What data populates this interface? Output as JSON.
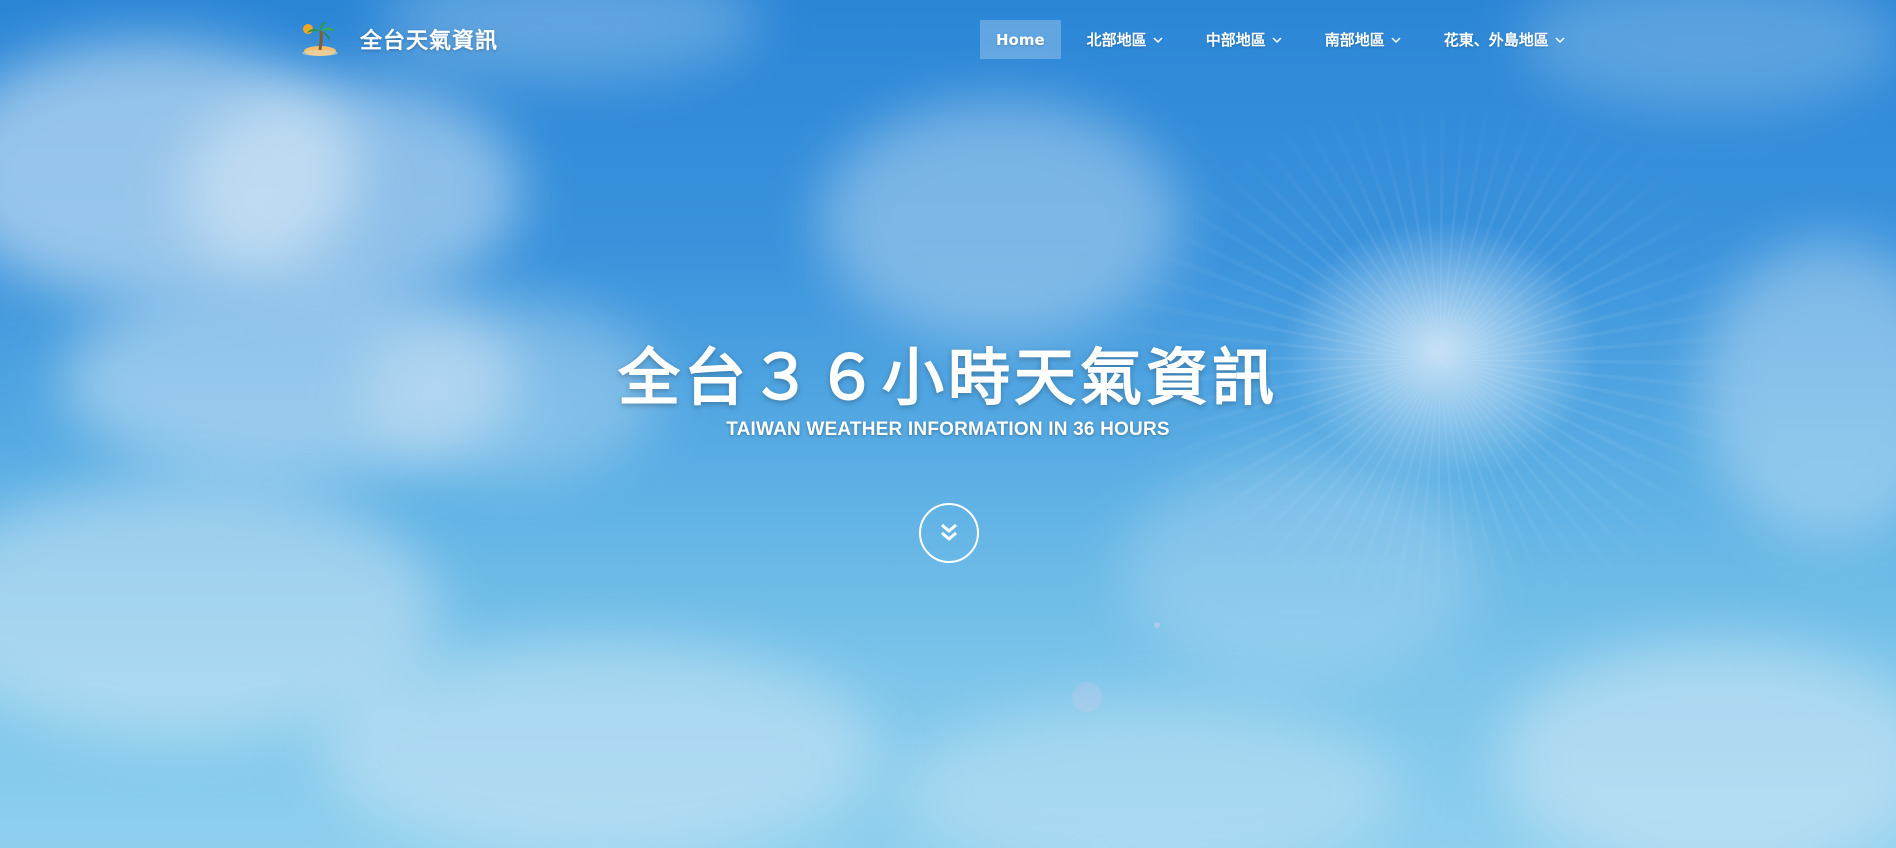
{
  "brand": {
    "name": "全台天氣資訊",
    "logo_icon": "palm-island-icon"
  },
  "nav": {
    "items": [
      {
        "label": "Home",
        "active": true,
        "dropdown": false
      },
      {
        "label": "北部地區",
        "active": false,
        "dropdown": true
      },
      {
        "label": "中部地區",
        "active": false,
        "dropdown": true
      },
      {
        "label": "南部地區",
        "active": false,
        "dropdown": true
      },
      {
        "label": "花東、外島地區",
        "active": false,
        "dropdown": true
      }
    ]
  },
  "hero": {
    "title": "全台３６小時天氣資訊",
    "subtitle": "TAIWAN WEATHER INFORMATION IN 36 HOURS",
    "scroll_icon": "double-chevron-down-icon"
  },
  "colors": {
    "sky_top": "#2b86d6",
    "sky_bottom": "#8ecfee",
    "text": "#ffffff"
  }
}
